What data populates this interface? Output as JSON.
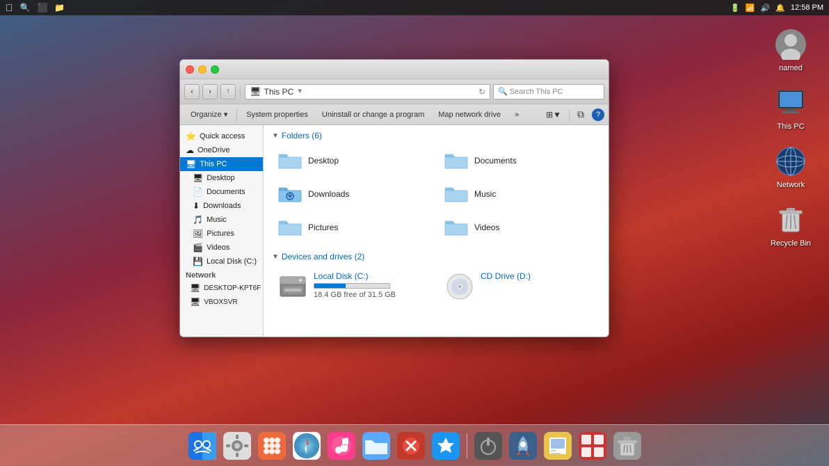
{
  "topbar": {
    "time": "12:58 PM",
    "apple": "",
    "icons": [
      "🔍",
      "⬛",
      "📁"
    ]
  },
  "desktop": {
    "icons": [
      {
        "id": "named",
        "label": "named",
        "type": "user"
      },
      {
        "id": "this-pc",
        "label": "This PC",
        "type": "monitor"
      },
      {
        "id": "network",
        "label": "Network",
        "type": "globe"
      },
      {
        "id": "recycle",
        "label": "Recycle Bin",
        "type": "trash"
      }
    ]
  },
  "explorer": {
    "title": "This PC",
    "breadcrumb": "This PC",
    "search_placeholder": "Search This PC",
    "toolbar": {
      "organize": "Organize ▾",
      "system_properties": "System properties",
      "uninstall": "Uninstall or change a program",
      "map_network": "Map network drive",
      "more": "»",
      "help": "?"
    },
    "folders_section": {
      "label": "Folders (6)",
      "items": [
        {
          "name": "Desktop"
        },
        {
          "name": "Documents"
        },
        {
          "name": "Downloads"
        },
        {
          "name": "Music"
        },
        {
          "name": "Pictures"
        },
        {
          "name": "Videos"
        }
      ]
    },
    "devices_section": {
      "label": "Devices and drives (2)",
      "items": [
        {
          "name": "Local Disk (C:)",
          "free": "18.4 GB free of 31.5 GB",
          "used_pct": 42,
          "type": "hdd"
        },
        {
          "name": "CD Drive (D:)",
          "type": "cd"
        }
      ]
    },
    "sidebar": {
      "sections": [
        {
          "label": "",
          "items": [
            {
              "id": "quick-access",
              "label": "Quick access",
              "icon": "⭐"
            },
            {
              "id": "onedrive",
              "label": "OneDrive",
              "icon": "☁"
            },
            {
              "id": "this-pc",
              "label": "This PC",
              "icon": "🖥",
              "active": true
            }
          ]
        },
        {
          "label": "",
          "items": [
            {
              "id": "desktop",
              "label": "Desktop",
              "icon": "🖥",
              "indent": true
            },
            {
              "id": "documents",
              "label": "Documents",
              "icon": "📄",
              "indent": true
            },
            {
              "id": "downloads",
              "label": "Downloads",
              "icon": "⬇",
              "indent": true
            },
            {
              "id": "music",
              "label": "Music",
              "icon": "🎵",
              "indent": true
            },
            {
              "id": "pictures",
              "label": "Pictures",
              "icon": "🖼",
              "indent": true
            },
            {
              "id": "videos",
              "label": "Videos",
              "icon": "🎬",
              "indent": true
            },
            {
              "id": "local-disk",
              "label": "Local Disk (C:)",
              "icon": "💾",
              "indent": true
            }
          ]
        },
        {
          "label": "Network",
          "items": [
            {
              "id": "desktop-kpt6f",
              "label": "DESKTOP-KPT6F",
              "icon": "🖥",
              "indent": true
            },
            {
              "id": "vboxsvr",
              "label": "VBOXSVR",
              "icon": "🖥",
              "indent": true
            }
          ]
        }
      ]
    }
  },
  "dock": {
    "items": [
      {
        "id": "finder",
        "label": "Finder",
        "color": "#1a74e4",
        "bg": "#fff"
      },
      {
        "id": "system-prefs",
        "label": "System Preferences",
        "color": "#888"
      },
      {
        "id": "launchpad",
        "label": "Launchpad",
        "color": "#ff6b6b"
      },
      {
        "id": "safari",
        "label": "Safari",
        "color": "#2d9fff"
      },
      {
        "id": "itunes",
        "label": "iTunes / Music",
        "color": "#fc3c8c"
      },
      {
        "id": "folder",
        "label": "Folder",
        "color": "#5aabff"
      },
      {
        "id": "close-app",
        "label": "Close App",
        "color": "#e0443e"
      },
      {
        "id": "app-store",
        "label": "App Store",
        "color": "#1997f0"
      },
      {
        "id": "power",
        "label": "Power",
        "color": "#aaa"
      },
      {
        "id": "rocket",
        "label": "Rocket",
        "color": "#6699cc"
      },
      {
        "id": "preview",
        "label": "Preview",
        "color": "#e8c44a"
      },
      {
        "id": "mosaic",
        "label": "Mosaic",
        "color": "#cc3333"
      },
      {
        "id": "trash",
        "label": "Trash",
        "color": "#aaa"
      }
    ]
  }
}
